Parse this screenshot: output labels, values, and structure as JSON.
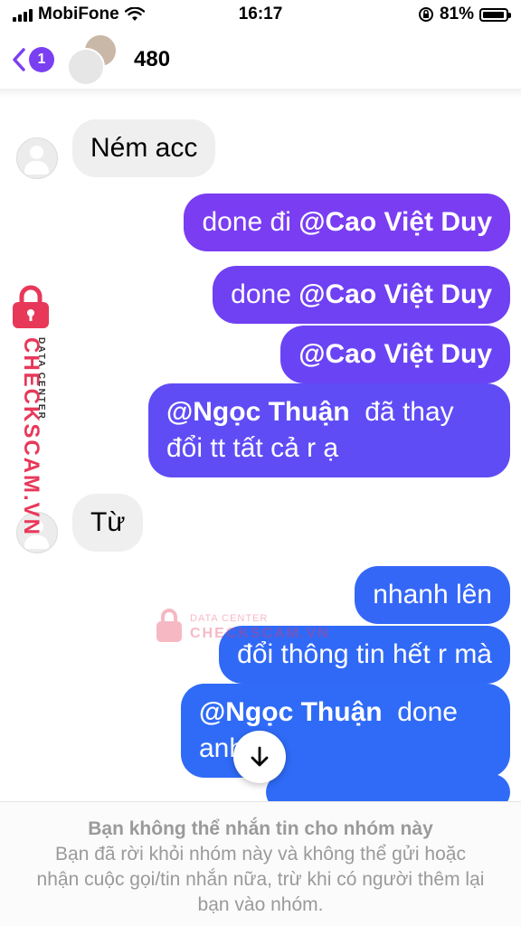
{
  "status_bar": {
    "carrier": "MobiFone",
    "time": "16:17",
    "battery": "81%",
    "battery_level": 0.81
  },
  "header": {
    "back_badge": "1",
    "group_name": "480"
  },
  "messages": {
    "m1": "Ném acc",
    "m2_text": "done đi ",
    "m2_mention": "@Cao Việt Duy",
    "m3_text": "done ",
    "m3_mention": "@Cao Việt Duy",
    "m4_mention": "@Cao Việt Duy",
    "m5_mention": "@Ngọc Thuận",
    "m5_line1_rest": "  đã thay",
    "m5_line2": "đổi tt tất cả r ạ",
    "m6": "Từ",
    "m7": "nhanh lên",
    "m8": "đổi thông tin hết r mà",
    "m9_mention": "@Ngọc Thuận",
    "m9_line1_rest": "  done",
    "m9_line2": "anh"
  },
  "watermark": {
    "brand": "CHECKSCAM.VN",
    "subtitle": "DATA CENTER"
  },
  "footer": {
    "title": "Bạn không thể nhắn tin cho nhóm này",
    "body": "Bạn đã rời khỏi nhóm này và không thể gửi hoặc nhận cuộc gọi/tin nhắn nữa, trừ khi có người thêm lại bạn vào nhóm."
  },
  "colors": {
    "accent": "#7b3ff2",
    "outgoing_top": "#7a3df2",
    "outgoing_mid": "#5b58f6",
    "outgoing_bottom": "#2f6bf7",
    "incoming": "#efefef",
    "watermark": "#e8385a"
  },
  "icons": {
    "back": "chevron-left-icon",
    "scroll": "arrow-down-icon",
    "lock": "lock-icon"
  }
}
